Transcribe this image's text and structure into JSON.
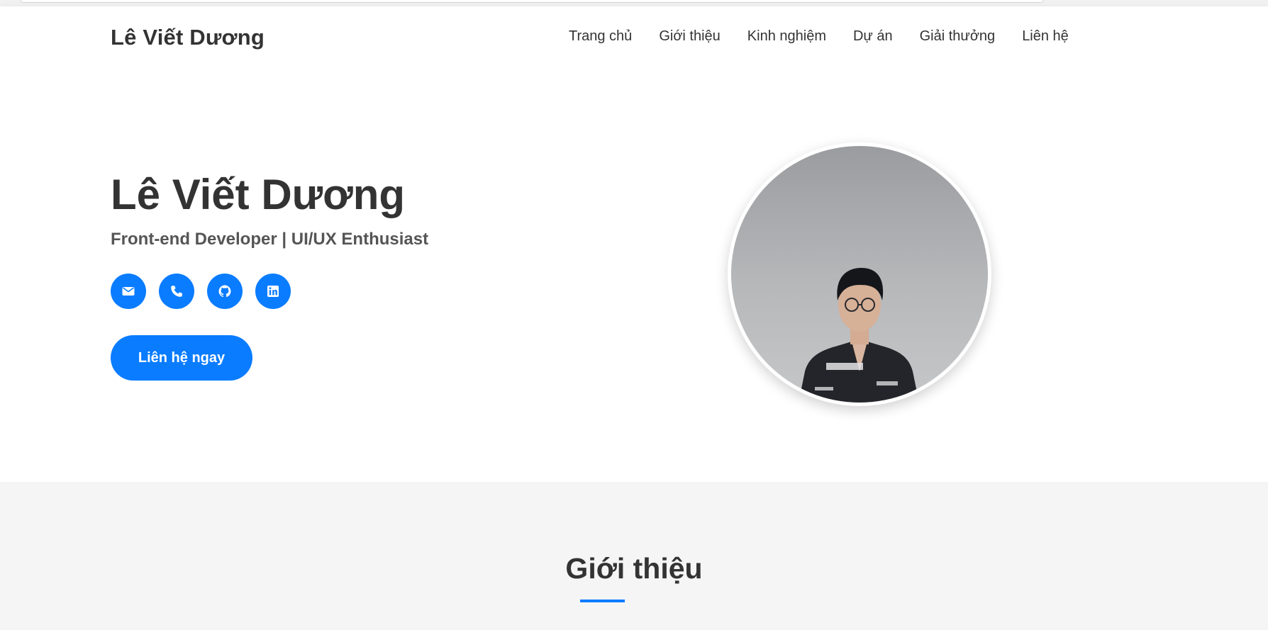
{
  "navbar": {
    "brand": "Lê Viết Dương",
    "links": [
      {
        "label": "Trang chủ"
      },
      {
        "label": "Giới thiệu"
      },
      {
        "label": "Kinh nghiệm"
      },
      {
        "label": "Dự án"
      },
      {
        "label": "Giải thưởng"
      },
      {
        "label": "Liên hệ"
      }
    ]
  },
  "hero": {
    "name": "Lê Viết Dương",
    "subtitle": "Front-end Developer | UI/UX Enthusiast",
    "socials": [
      {
        "icon": "envelope-icon"
      },
      {
        "icon": "phone-icon"
      },
      {
        "icon": "github-icon"
      },
      {
        "icon": "linkedin-icon"
      }
    ],
    "cta_label": "Liên hệ ngay"
  },
  "about": {
    "title": "Giới thiệu"
  },
  "colors": {
    "accent": "#0a7cff",
    "text": "#333333",
    "section_bg": "#f5f5f5"
  }
}
